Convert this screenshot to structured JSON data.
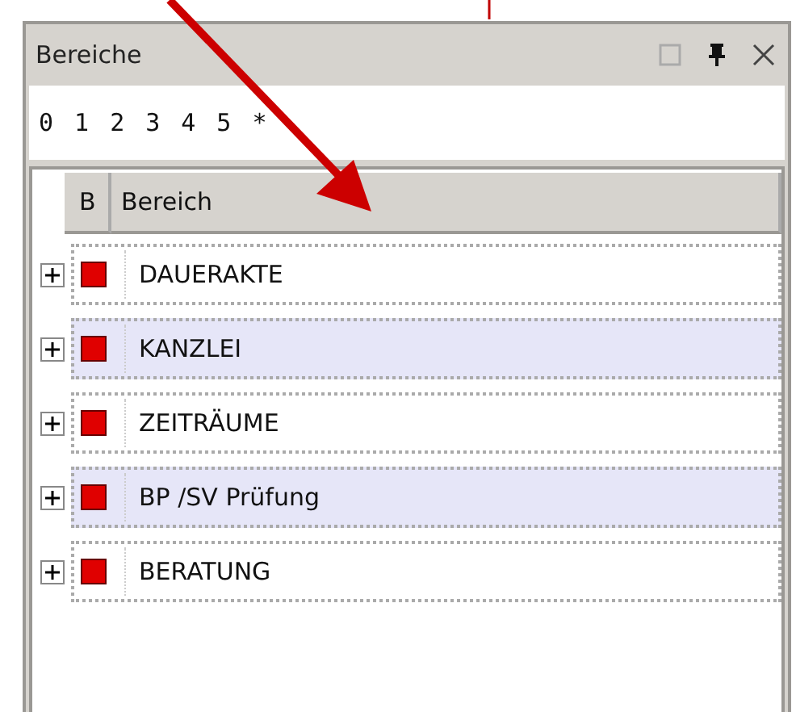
{
  "panel": {
    "title": "Bereiche"
  },
  "levels": [
    "0",
    "1",
    "2",
    "3",
    "4",
    "5",
    "*"
  ],
  "table": {
    "columns": [
      "B",
      "Bereich"
    ],
    "rows": [
      {
        "label": "DAUERAKTE",
        "expanded": false
      },
      {
        "label": "KANZLEI",
        "expanded": false
      },
      {
        "label": "ZEITRÄUME",
        "expanded": false
      },
      {
        "label": "BP /SV Prüfung",
        "expanded": false
      },
      {
        "label": "BERATUNG",
        "expanded": false
      }
    ]
  }
}
